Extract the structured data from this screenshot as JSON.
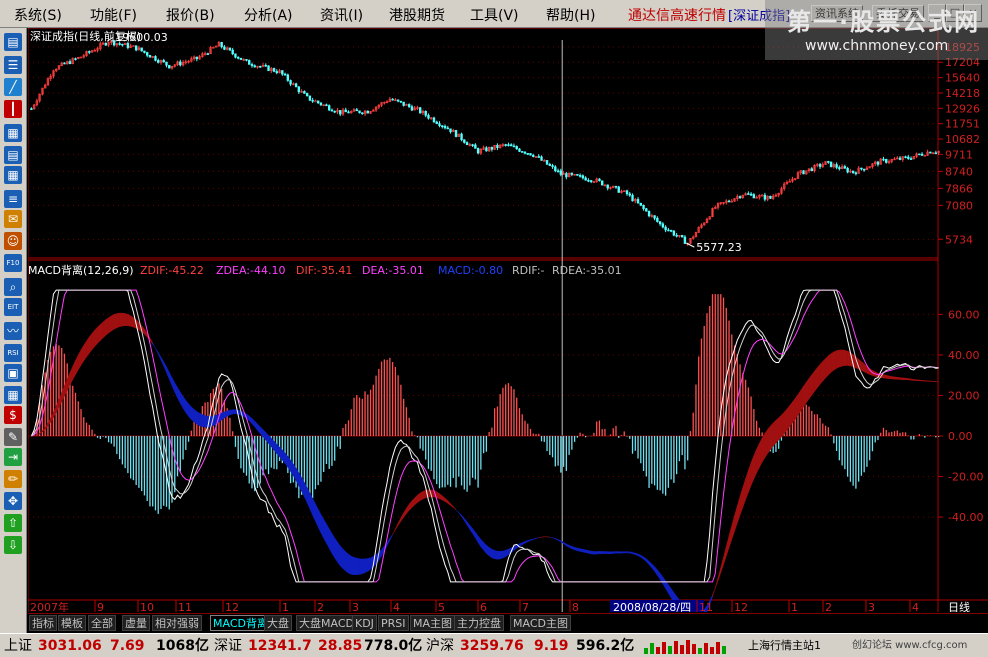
{
  "menu": {
    "items": [
      "系统(S)",
      "功能(F)",
      "报价(B)",
      "分析(A)",
      "资讯(I)",
      "港股期货",
      "工具(V)",
      "帮助(H)"
    ],
    "market_title": "通达信高速行情",
    "index_title": "[深证成指]",
    "info_btn": "资讯系统",
    "trade_btn": "委托交易",
    "minimize": "_",
    "restore": "□",
    "close": "×"
  },
  "watermark": {
    "line1": "第一·股票公式网",
    "line2": "www.chnmoney.com"
  },
  "toolbar": {
    "icons": [
      "chart-icon",
      "list-icon",
      "line-icon",
      "candle-icon",
      "window-icon",
      "table-icon",
      "grid-icon",
      "report-icon",
      "mail-icon",
      "users-icon",
      "f10-icon",
      "search-icon",
      "eit-icon",
      "wave-icon",
      "rsi-icon",
      "screen-icon",
      "calc-icon",
      "dollar-icon",
      "tool-icon",
      "exit-icon",
      "pencil-icon",
      "move-icon",
      "arrow-up-icon",
      "arrow-down-icon"
    ],
    "labels": [
      "▤",
      "☰",
      "╱",
      "┃",
      "▦",
      "▤",
      "▦",
      "≡",
      "✉",
      "☺",
      "F10",
      "⌕",
      "EIT",
      "〰",
      "RSI",
      "▣",
      "▦",
      "$",
      "✎",
      "⇥",
      "✏",
      "✥",
      "⇧",
      "⇩"
    ],
    "colors": [
      "#1a5fb4",
      "#1a5fb4",
      "#2080d0",
      "#c00000",
      "#1a5fb4",
      "#1a5fb4",
      "#1a5fb4",
      "#1a5fb4",
      "#d08000",
      "#c05000",
      "#1a5fb4",
      "#1a5fb4",
      "#1a5fb4",
      "#1a5fb4",
      "#1a5fb4",
      "#1a5fb4",
      "#1a5fb4",
      "#c00000",
      "#606060",
      "#20a040",
      "#d08000",
      "#1a5fb4",
      "#20a020",
      "#20a020"
    ]
  },
  "price_panel": {
    "title": "深证成指(日线,前复权)",
    "high_label": "19600.03",
    "low_label": "5577.23",
    "axis_ticks": [
      "18925",
      "17204",
      "15640",
      "14218",
      "12926",
      "11751",
      "10682",
      "9711",
      "8740",
      "7866",
      "7080",
      "5734"
    ]
  },
  "macd_panel": {
    "title": "MACD背离(12,26,9)",
    "zdif": "ZDIF:-45.22",
    "zdea": "ZDEA:-44.10",
    "dif": "DIF:-35.41",
    "dea": "DEA:-35.01",
    "macd": "MACD:-0.80",
    "rdif": "RDIF:-",
    "rdea": "RDEA:-35.01",
    "axis_ticks": [
      "60.00",
      "40.00",
      "20.00",
      "0.00",
      "-20.00",
      "-40.00"
    ]
  },
  "time_axis": {
    "labels": [
      "2007年",
      "9",
      "10",
      "11",
      "12",
      "1",
      "2",
      "3",
      "4",
      "5",
      "6",
      "7",
      "8",
      "2008/08/28/四",
      "11",
      "12",
      "1",
      "2",
      "3",
      "4"
    ],
    "period": "日线"
  },
  "tabs": [
    "指标",
    "模板",
    "全部",
    "虚量",
    "相对强弱",
    "MACD背离",
    "大盘",
    "大盘MACD",
    "KDJ",
    "PRSI",
    "MA主图",
    "主力控盘",
    "MACD主图"
  ],
  "active_tab": "MACD背离",
  "status": {
    "sh_name": "上证",
    "sh_val": "3031.06",
    "sh_chg": "7.69",
    "sh_amt": "1068亿",
    "sz_name": "深证",
    "sz_val": "12341.7",
    "sz_chg": "28.85",
    "sz_amt": "778.0亿",
    "hs_name": "沪深",
    "hs_val": "3259.76",
    "hs_chg": "9.19",
    "hs_amt": "596.2亿",
    "station": "上海行情主站1",
    "footer": "创幻论坛 www.cfcg.com"
  },
  "chart_data": {
    "type": "candlestick+macd",
    "price_axis": [
      "18925",
      "17204",
      "15640",
      "14218",
      "12926",
      "11751",
      "10682",
      "9711",
      "8740",
      "7866",
      "7080",
      "5734"
    ],
    "price_high": 19600.03,
    "price_low": 5577.23,
    "macd_axis": [
      60,
      40,
      20,
      0,
      -20,
      -40
    ],
    "price_trend_keypoints": [
      [
        0,
        12900
      ],
      [
        8,
        16500
      ],
      [
        18,
        17800
      ],
      [
        28,
        19600
      ],
      [
        38,
        18800
      ],
      [
        50,
        16800
      ],
      [
        60,
        17600
      ],
      [
        68,
        19200
      ],
      [
        78,
        17200
      ],
      [
        90,
        16200
      ],
      [
        100,
        13800
      ],
      [
        112,
        12600
      ],
      [
        122,
        12700
      ],
      [
        130,
        13700
      ],
      [
        140,
        12800
      ],
      [
        152,
        11300
      ],
      [
        162,
        9900
      ],
      [
        172,
        10300
      ],
      [
        182,
        9700
      ],
      [
        192,
        8600
      ],
      [
        204,
        8300
      ],
      [
        216,
        7600
      ],
      [
        228,
        6300
      ],
      [
        238,
        5600
      ],
      [
        248,
        7000
      ],
      [
        258,
        7600
      ],
      [
        268,
        7400
      ],
      [
        278,
        8600
      ],
      [
        288,
        9200
      ],
      [
        298,
        8700
      ],
      [
        308,
        9300
      ],
      [
        318,
        9500
      ],
      [
        326,
        9900
      ]
    ]
  }
}
